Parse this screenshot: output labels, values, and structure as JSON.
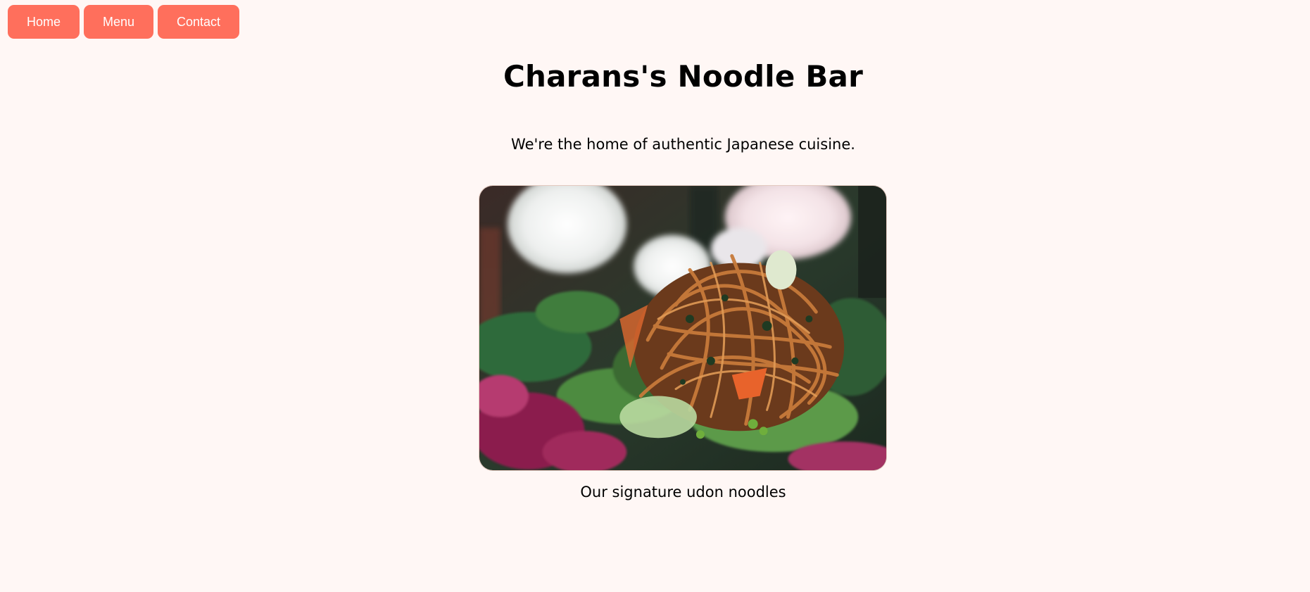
{
  "nav": {
    "home_label": "Home",
    "menu_label": "Menu",
    "contact_label": "Contact"
  },
  "hero": {
    "title": "Charans's Noodle Bar",
    "tagline": "We're the home of authentic Japanese cuisine.",
    "image_subject": "noodle-salad-photo",
    "caption": "Our signature udon noodles"
  },
  "colors": {
    "background": "#fff7f5",
    "button": "#ff6f5c",
    "button_text": "#ffffff"
  }
}
